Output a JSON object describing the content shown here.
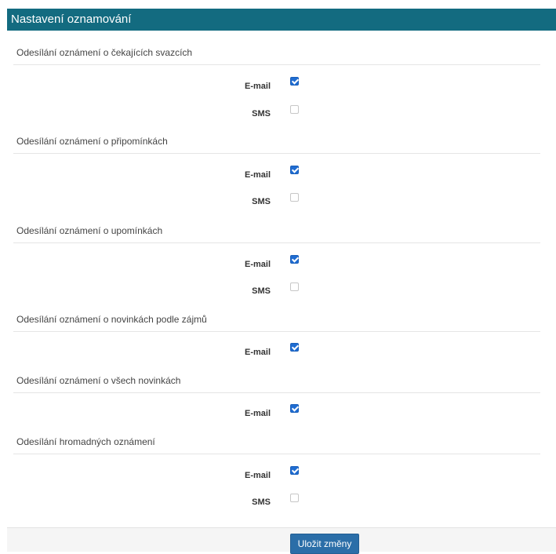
{
  "header": {
    "title": "Nastavení oznamování"
  },
  "sections": [
    {
      "title": "Odesílání oznámení o čekajících svazcích",
      "options": [
        {
          "label": "E-mail",
          "checked": true
        },
        {
          "label": "SMS",
          "checked": false
        }
      ]
    },
    {
      "title": "Odesílání oznámení o připomínkách",
      "options": [
        {
          "label": "E-mail",
          "checked": true
        },
        {
          "label": "SMS",
          "checked": false
        }
      ]
    },
    {
      "title": "Odesílání oznámení o upomínkách",
      "options": [
        {
          "label": "E-mail",
          "checked": true
        },
        {
          "label": "SMS",
          "checked": false
        }
      ]
    },
    {
      "title": "Odesílání oznámení o novinkách podle zájmů",
      "options": [
        {
          "label": "E-mail",
          "checked": true
        }
      ]
    },
    {
      "title": "Odesílání oznámení o všech novinkách",
      "options": [
        {
          "label": "E-mail",
          "checked": true
        }
      ]
    },
    {
      "title": "Odesílání hromadných oznámení",
      "options": [
        {
          "label": "E-mail",
          "checked": true
        },
        {
          "label": "SMS",
          "checked": false
        }
      ]
    }
  ],
  "footer": {
    "save_label": "Uložit změny"
  },
  "colors": {
    "header_bg": "#136b80",
    "checkbox_checked": "#1f6cd1",
    "button_bg": "#2b6ea8"
  }
}
